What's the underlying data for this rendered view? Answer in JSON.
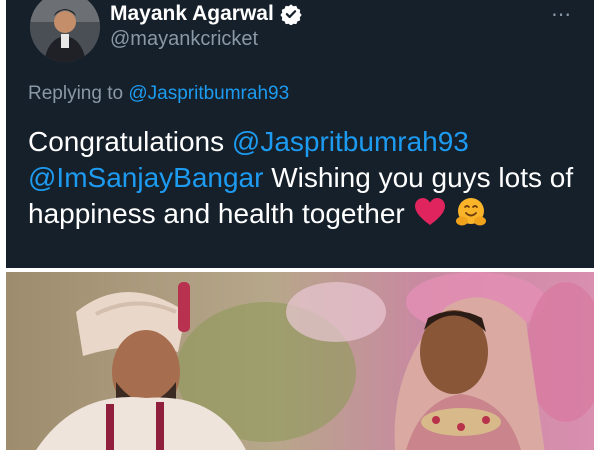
{
  "tweet": {
    "author_name": "Mayank Agarwal",
    "author_handle": "@mayankcricket",
    "more_icon": "⋯",
    "reply_prefix": "Replying to",
    "reply_handle": "@Jaspritbumrah93",
    "text_prefix": "Congratulations",
    "mention_1": "@Jaspritbumrah93",
    "mention_2": "@ImSanjayBangar",
    "text_suffix": "Wishing you guys lots of happiness and health together",
    "emojis": [
      "red-heart-icon",
      "hugging-face-icon"
    ]
  },
  "icons": {
    "verified": "verified-badge-icon",
    "more": "more-options-icon"
  },
  "colors": {
    "card_background": "#15202b",
    "link": "#1d9bf0",
    "secondary_text": "#8b98a5",
    "heart": "#e0245e",
    "hug_emoji": "#f9b429"
  }
}
